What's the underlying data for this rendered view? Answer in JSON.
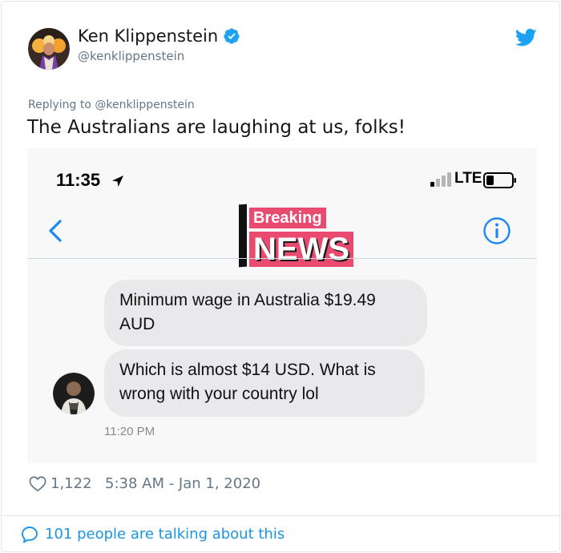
{
  "author": {
    "display_name": "Ken Klippenstein",
    "handle": "@kenklippenstein",
    "verified": true,
    "avatar_icon": "user-avatar"
  },
  "tweet": {
    "replying_to": "Replying to @kenklippenstein",
    "text": "The Australians are laughing at us, folks!"
  },
  "media": {
    "status_bar": {
      "time": "11:35",
      "carrier": "LTE"
    },
    "contact_logo": {
      "top": "Breaking",
      "bottom": "NEWS"
    },
    "messages": [
      {
        "text": "Minimum wage in Australia $19.49 AUD"
      },
      {
        "text": "Which is almost $14 USD. What is wrong with your country lol"
      }
    ],
    "message_time": "11:20 PM"
  },
  "footer": {
    "likes": "1,122",
    "timestamp": "5:38 AM - Jan 1, 2020",
    "talking": "101 people are talking about this"
  },
  "colors": {
    "twitter_blue": "#1da1f2",
    "link_blue": "#1b95e0",
    "secondary_text": "#657786",
    "ios_blue": "#1f87f2",
    "bubble_gray": "#e9e9eb",
    "news_pink": "#e84a70"
  }
}
